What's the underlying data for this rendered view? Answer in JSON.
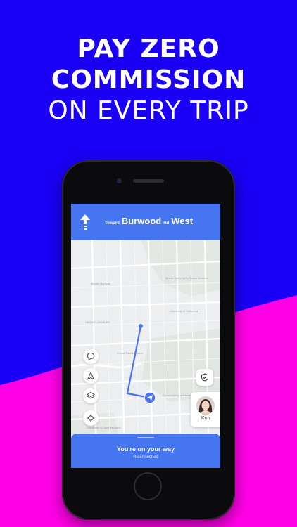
{
  "headline": {
    "line1": "PAY ZERO",
    "line2": "COMMISSION",
    "line3": "ON EVERY TRIP"
  },
  "colors": {
    "background_blue": "#1a00f5",
    "background_pink": "#ff00e6",
    "app_blue": "#4575f0",
    "route_blue": "#4a73f0"
  },
  "navigation": {
    "toward_label": "Toward",
    "street_name": "Burwood",
    "street_suffix": "Rd",
    "direction": "West",
    "maneuver_icon": "arrow-up-icon"
  },
  "map": {
    "labels": {
      "mount_olympus": "Mount Olympus",
      "mount_sutro": "Mount Sutro Open Space Reserve",
      "ucsf": "University of California",
      "haight_ashbury": "HAIGHT-ASHBURY",
      "whole_foods": "Whole Foods Market",
      "conservatory": "Conservatory of Flowers",
      "university_sf": "University of San Francisco"
    },
    "side_buttons": [
      "chat-icon",
      "navigate-icon",
      "layers-icon",
      "locate-icon"
    ],
    "safety_icon": "shield-icon"
  },
  "rider": {
    "name": "Kim"
  },
  "status": {
    "title": "You're on your way",
    "subtitle": "Rider notified"
  }
}
